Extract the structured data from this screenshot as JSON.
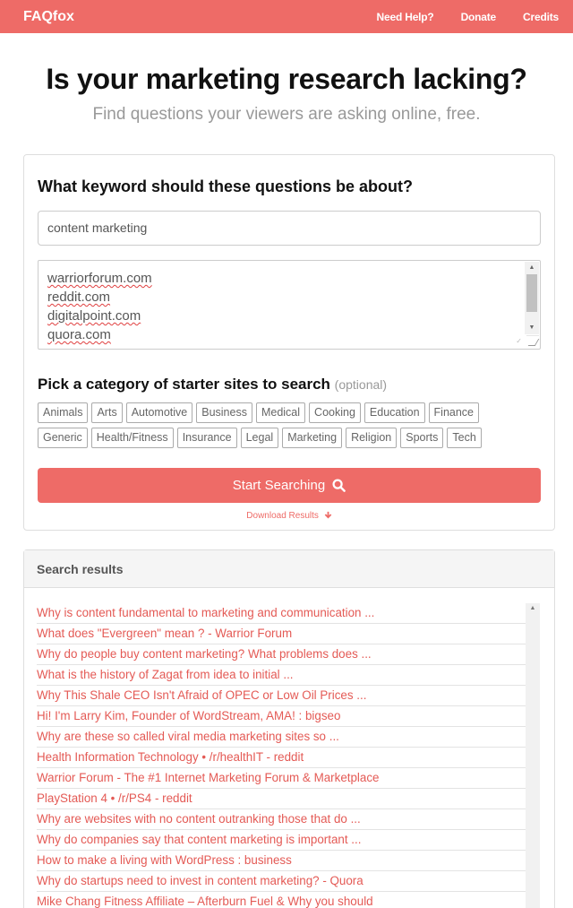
{
  "nav": {
    "brand": "FAQfox",
    "links": [
      "Need Help?",
      "Donate",
      "Credits"
    ]
  },
  "hero": {
    "title": "Is your marketing research lacking?",
    "subtitle": "Find questions your viewers are asking online, free."
  },
  "search": {
    "keyword_label": "What keyword should these questions be about?",
    "keyword_value": "content marketing",
    "sites": [
      "warriorforum.com",
      "reddit.com",
      "digitalpoint.com",
      "quora.com"
    ],
    "category_label": "Pick a category of starter sites to search",
    "optional_label": "(optional)",
    "categories": [
      "Animals",
      "Arts",
      "Automotive",
      "Business",
      "Medical",
      "Cooking",
      "Education",
      "Finance",
      "Generic",
      "Health/Fitness",
      "Insurance",
      "Legal",
      "Marketing",
      "Religion",
      "Sports",
      "Tech"
    ],
    "start_button": "Start Searching",
    "download_label": "Download Results"
  },
  "results": {
    "header": "Search results",
    "items": [
      "Why is content fundamental to marketing and communication ...",
      "What does \"Evergreen\" mean ? - Warrior Forum",
      "Why do people buy content marketing? What problems does ...",
      "What is the history of Zagat from idea to initial ...",
      "Why This Shale CEO Isn't Afraid of OPEC or Low Oil Prices ...",
      "Hi! I'm Larry Kim, Founder of WordStream, AMA! : bigseo",
      "Why are these so called viral media marketing sites so ...",
      "Health Information Technology • /r/healthIT - reddit",
      "Warrior Forum - The #1 Internet Marketing Forum & Marketplace",
      "PlayStation 4 • /r/PS4 - reddit",
      "Why are websites with no content outranking those that do ...",
      "Why do companies say that content marketing is important ...",
      "How to make a living with WordPress : business",
      "Why do startups need to invest in content marketing? - Quora",
      "Mike Chang Fitness Affiliate – Afterburn Fuel & Why you should"
    ]
  },
  "colors": {
    "accent": "#ee6b67",
    "link": "#e45a55"
  }
}
